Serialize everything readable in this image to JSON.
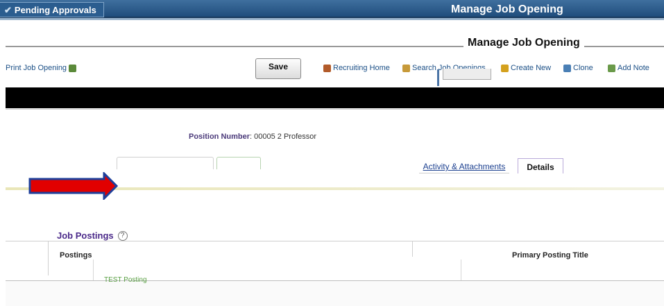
{
  "header": {
    "pending_label": "Pending Approvals",
    "title": "Manage Job Opening"
  },
  "subheader": {
    "title": "Manage Job Opening"
  },
  "toolbar": {
    "print_label": "Print Job Opening",
    "save_label": "Save",
    "recruiting_home_label": "Recruiting Home",
    "search_label": "Search Job Openings",
    "create_new_label": "Create New",
    "clone_label": "Clone",
    "add_note_label": "Add Note"
  },
  "position": {
    "label": "Position Number",
    "value": "00005 2 Professor"
  },
  "tabs": [
    {
      "label": "Activity & Attachments",
      "active": false
    },
    {
      "label": "Details",
      "active": true
    }
  ],
  "job_postings": {
    "title": "Job Postings",
    "columns": [
      "Postings",
      "Primary Posting Title"
    ],
    "rows": [
      {
        "posting": "TEST Posting",
        "title": ""
      }
    ]
  },
  "colors": {
    "banner": "#2b5d8f",
    "accent_purple": "#4b2a8a",
    "arrow_red": "#e10000",
    "link_blue": "#1b4f86"
  },
  "icons": [
    "checkmark-icon",
    "print-icon",
    "home-icon",
    "search-icon",
    "create-icon",
    "clone-icon",
    "note-icon",
    "help-icon",
    "arrow-right-icon"
  ]
}
